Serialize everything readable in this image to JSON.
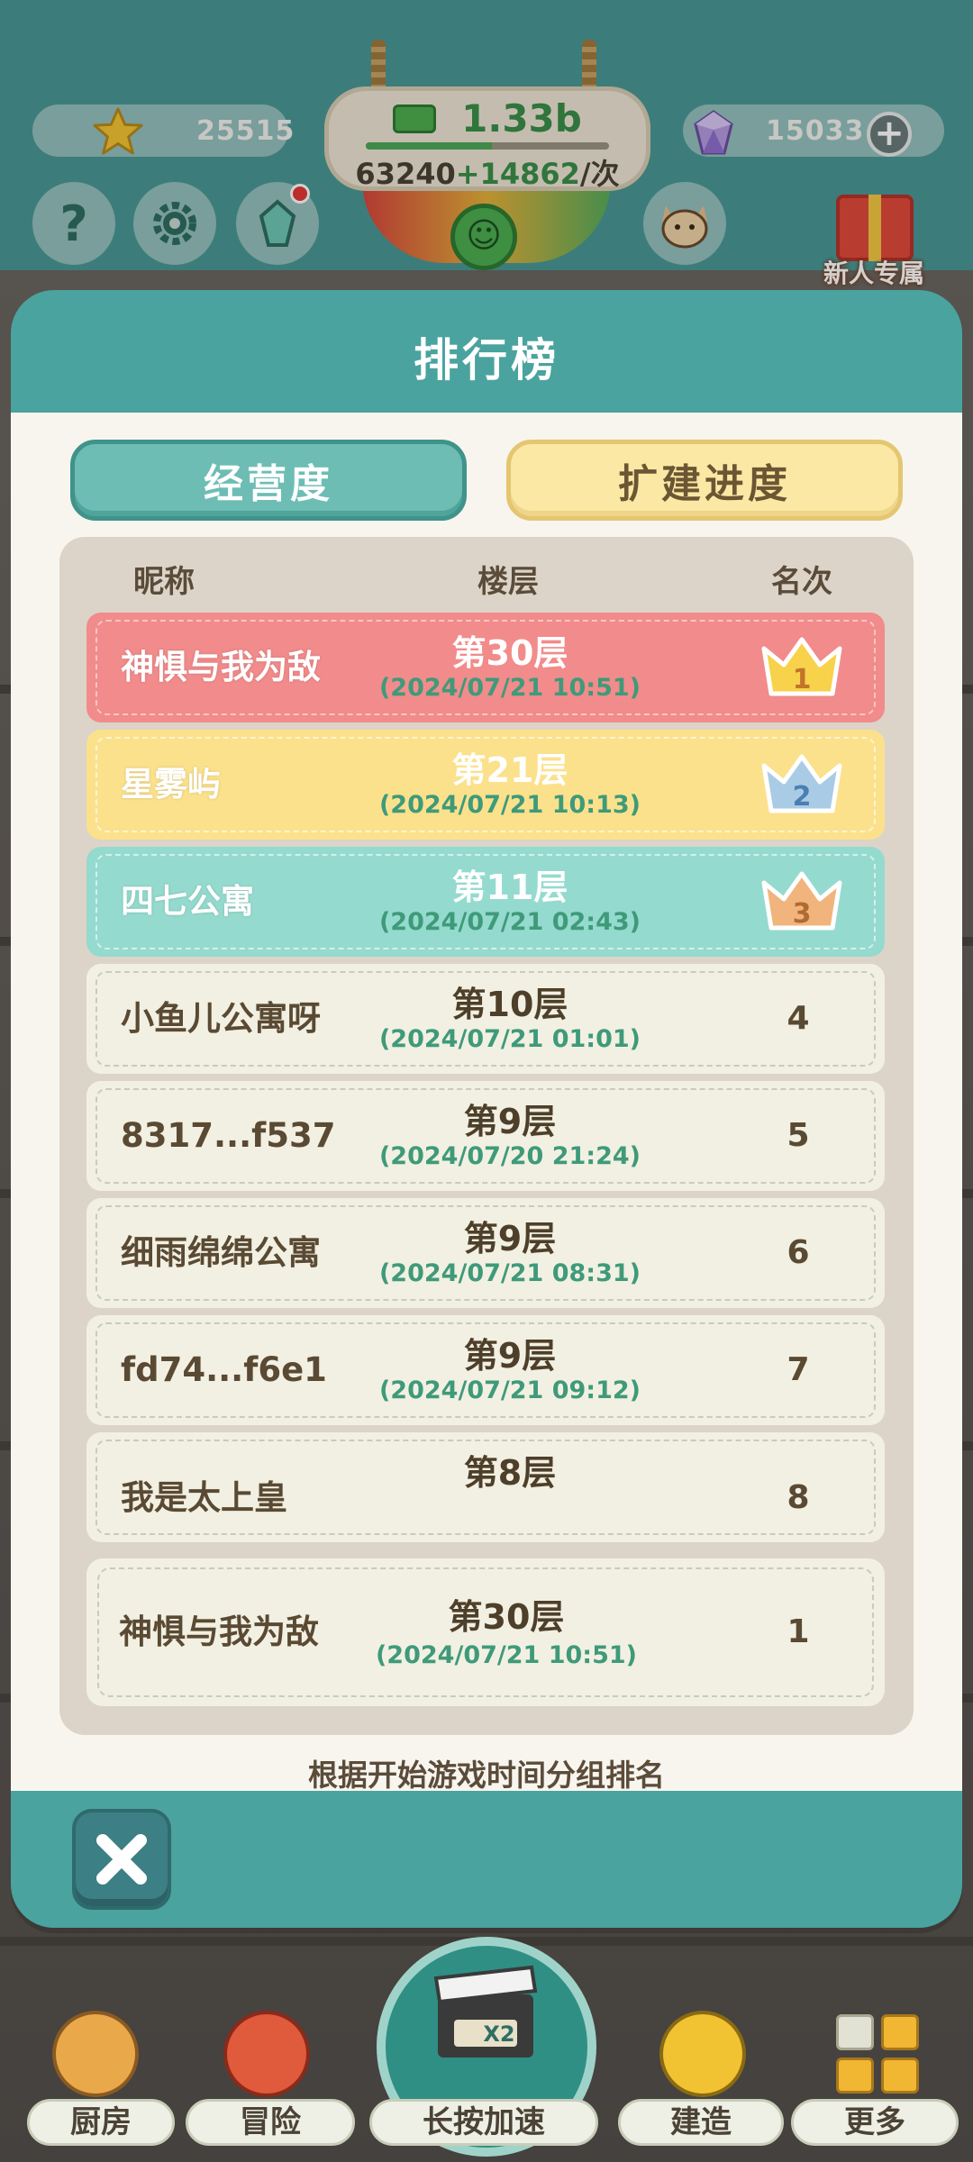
{
  "hud": {
    "stars": "25515",
    "gems": "15033",
    "money": "1.33b",
    "income_base": "63240",
    "income_bonus": "+14862",
    "income_unit": "/次",
    "money_progress": 0.52,
    "gift_label": "新人专属"
  },
  "modal": {
    "title": "排行榜",
    "tabs": [
      {
        "label": "经营度",
        "active": true
      },
      {
        "label": "扩建进度",
        "active": false
      }
    ],
    "columns": {
      "name": "昵称",
      "floor": "楼层",
      "rank": "名次"
    },
    "rows": [
      {
        "name": "神惧与我为敌",
        "floor": "第30层",
        "time": "(2024/07/21 10:51)",
        "rank": "1"
      },
      {
        "name": "星雾屿",
        "floor": "第21层",
        "time": "(2024/07/21 10:13)",
        "rank": "2"
      },
      {
        "name": "四七公寓",
        "floor": "第11层",
        "time": "(2024/07/21 02:43)",
        "rank": "3"
      },
      {
        "name": "小鱼儿公寓呀",
        "floor": "第10层",
        "time": "(2024/07/21 01:01)",
        "rank": "4"
      },
      {
        "name": "8317...f537",
        "floor": "第9层",
        "time": "(2024/07/20 21:24)",
        "rank": "5"
      },
      {
        "name": "细雨绵绵公寓",
        "floor": "第9层",
        "time": "(2024/07/21 08:31)",
        "rank": "6"
      },
      {
        "name": "fd74...f6e1",
        "floor": "第9层",
        "time": "(2024/07/21 09:12)",
        "rank": "7"
      },
      {
        "name": "我是太上皇",
        "floor": "第8层",
        "time": "",
        "rank": "8"
      }
    ],
    "my_row": {
      "name": "神惧与我为敌",
      "floor": "第30层",
      "time": "(2024/07/21 10:51)",
      "rank": "1"
    },
    "footnote": "根据开始游戏时间分组排名"
  },
  "nav": {
    "kitchen": "厨房",
    "adventure": "冒险",
    "speed": "长按加速",
    "build": "建造",
    "more": "更多",
    "speed_badge": "X2"
  },
  "colors": {
    "teal": "#4aa39e",
    "rank1": "#f28b8b",
    "rank2": "#fbe18c",
    "rank3": "#95dace",
    "time_green": "#3f9a7a"
  }
}
